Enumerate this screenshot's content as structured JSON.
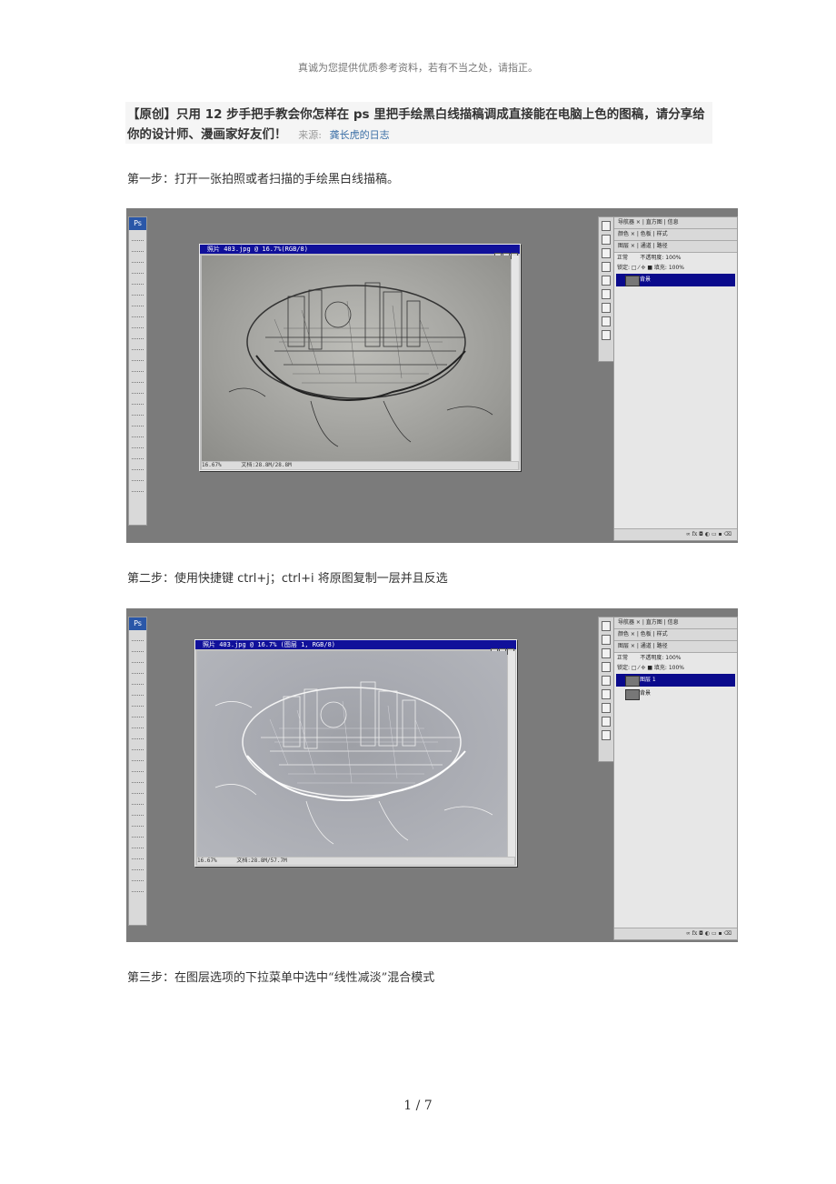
{
  "header_note": "真诚为您提供优质参考资料，若有不当之处，请指正。",
  "title": {
    "text": "【原创】只用 12 步手把手教会你怎样在 ps 里把手绘黑白线描稿调成直接能在电脑上色的图稿，请分享给你的设计师、漫画家好友们！",
    "source_label": "来源:",
    "source_link": "龚长虎的日志"
  },
  "steps": [
    {
      "label": "第一步：",
      "text": "打开一张拍照或者扫描的手绘黑白线描稿。"
    },
    {
      "label": "第二步：",
      "text_pre": "使用快捷键 ",
      "text_keys": "ctrl+j；ctrl+i",
      "text_post": " 将原图复制一层并且反选"
    },
    {
      "label": "第三步：",
      "text": "在图层选项的下拉菜单中选中“线性减淡”混合模式"
    }
  ],
  "screenshot1": {
    "doc_title": "照片 403.jpg @ 16.7%(RGB/8)",
    "status_zoom": "16.67%",
    "status_doc": "文档:28.8M/28.8M",
    "panel_tabs": [
      "导航器 × | 直方图 | 信息",
      "颜色 × | 色板 | 样式",
      "图层 × | 通道 | 路径"
    ],
    "blend_mode": "正常",
    "opacity": "不透明度: 100%",
    "fill": "锁定: □ ⁄ ✢ ■    填充: 100%",
    "layers": [
      {
        "name": "背景",
        "selected": true
      }
    ]
  },
  "screenshot2": {
    "doc_title": "照片 403.jpg @ 16.7% (图层 1, RGB/8)",
    "status_zoom": "16.67%",
    "status_doc": "文档:28.8M/57.7M",
    "panel_tabs": [
      "导航器 × | 直方图 | 信息",
      "颜色 × | 色板 | 样式",
      "图层 × | 通道 | 路径"
    ],
    "blend_mode": "正常",
    "opacity": "不透明度: 100%",
    "fill": "锁定: □ ⁄ ✢ ■    填充: 100%",
    "layers": [
      {
        "name": "图层 1",
        "selected": true
      },
      {
        "name": "背景",
        "selected": false
      }
    ]
  },
  "page_number": "1 / 7",
  "colors": {
    "ps_gray": "#7b7b7b",
    "title_bar": "#10109a",
    "link": "#3a6ea5"
  }
}
